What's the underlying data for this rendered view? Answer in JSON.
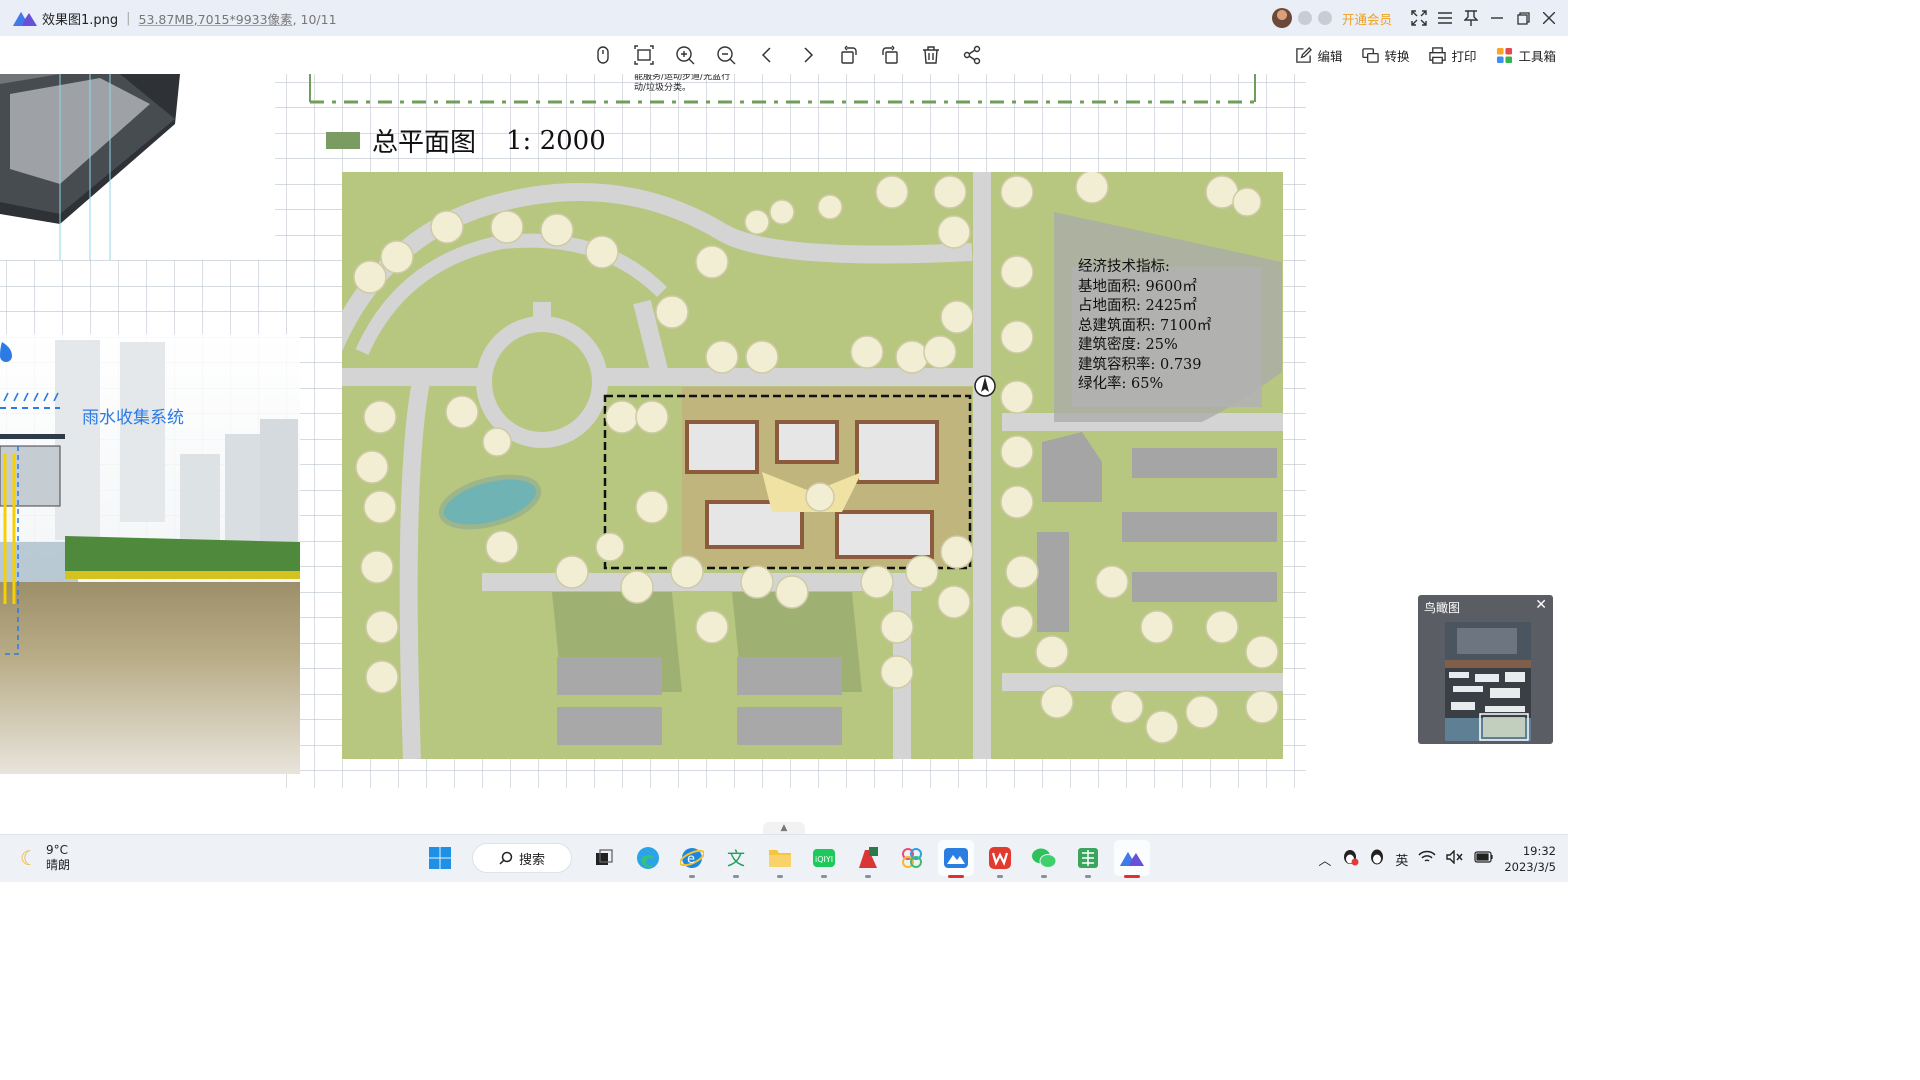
{
  "titlebar": {
    "filename": "效果图1.png",
    "filesize": "53.87MB",
    "dimensions": ",7015*9933像素",
    "index": ", 10/11",
    "vip_label": "开通会员"
  },
  "toolbar": {
    "tools": [
      "mouse-icon",
      "fit-icon",
      "zoom-in-icon",
      "zoom-out-icon",
      "prev-icon",
      "next-icon",
      "rotate-left-icon",
      "rotate-right-icon",
      "delete-icon",
      "share-icon"
    ],
    "edit_label": "编辑",
    "convert_label": "转换",
    "print_label": "打印",
    "toolbox_label": "工具箱"
  },
  "poster": {
    "plan_title": "总平面图",
    "plan_scale": "1:  2000",
    "rain_label": "雨水收集系统",
    "top_note_1": "能服务/运动步道/光盆行",
    "top_note_2": "动/垃圾分类。",
    "stats": {
      "heading": "经济技术指标:",
      "lines": [
        "基地面积: 9600㎡",
        "占地面积: 2425㎡",
        "总建筑面积: 7100㎡",
        "建筑密度: 25%",
        "建筑容积率: 0.739",
        "绿化率: 65%"
      ]
    }
  },
  "birdseye": {
    "title": "鸟瞰图"
  },
  "taskbar": {
    "weather_temp": "9°C",
    "weather_desc": "晴朗",
    "search_label": "搜索",
    "ime": "英",
    "time": "19:32",
    "date": "2023/3/5"
  },
  "colors": {
    "titlebar_bg": "#e9eef7",
    "vip": "#f0a020",
    "grass": "#b7c780",
    "road": "#d6d6d6",
    "rain_label": "#2c7be5"
  }
}
